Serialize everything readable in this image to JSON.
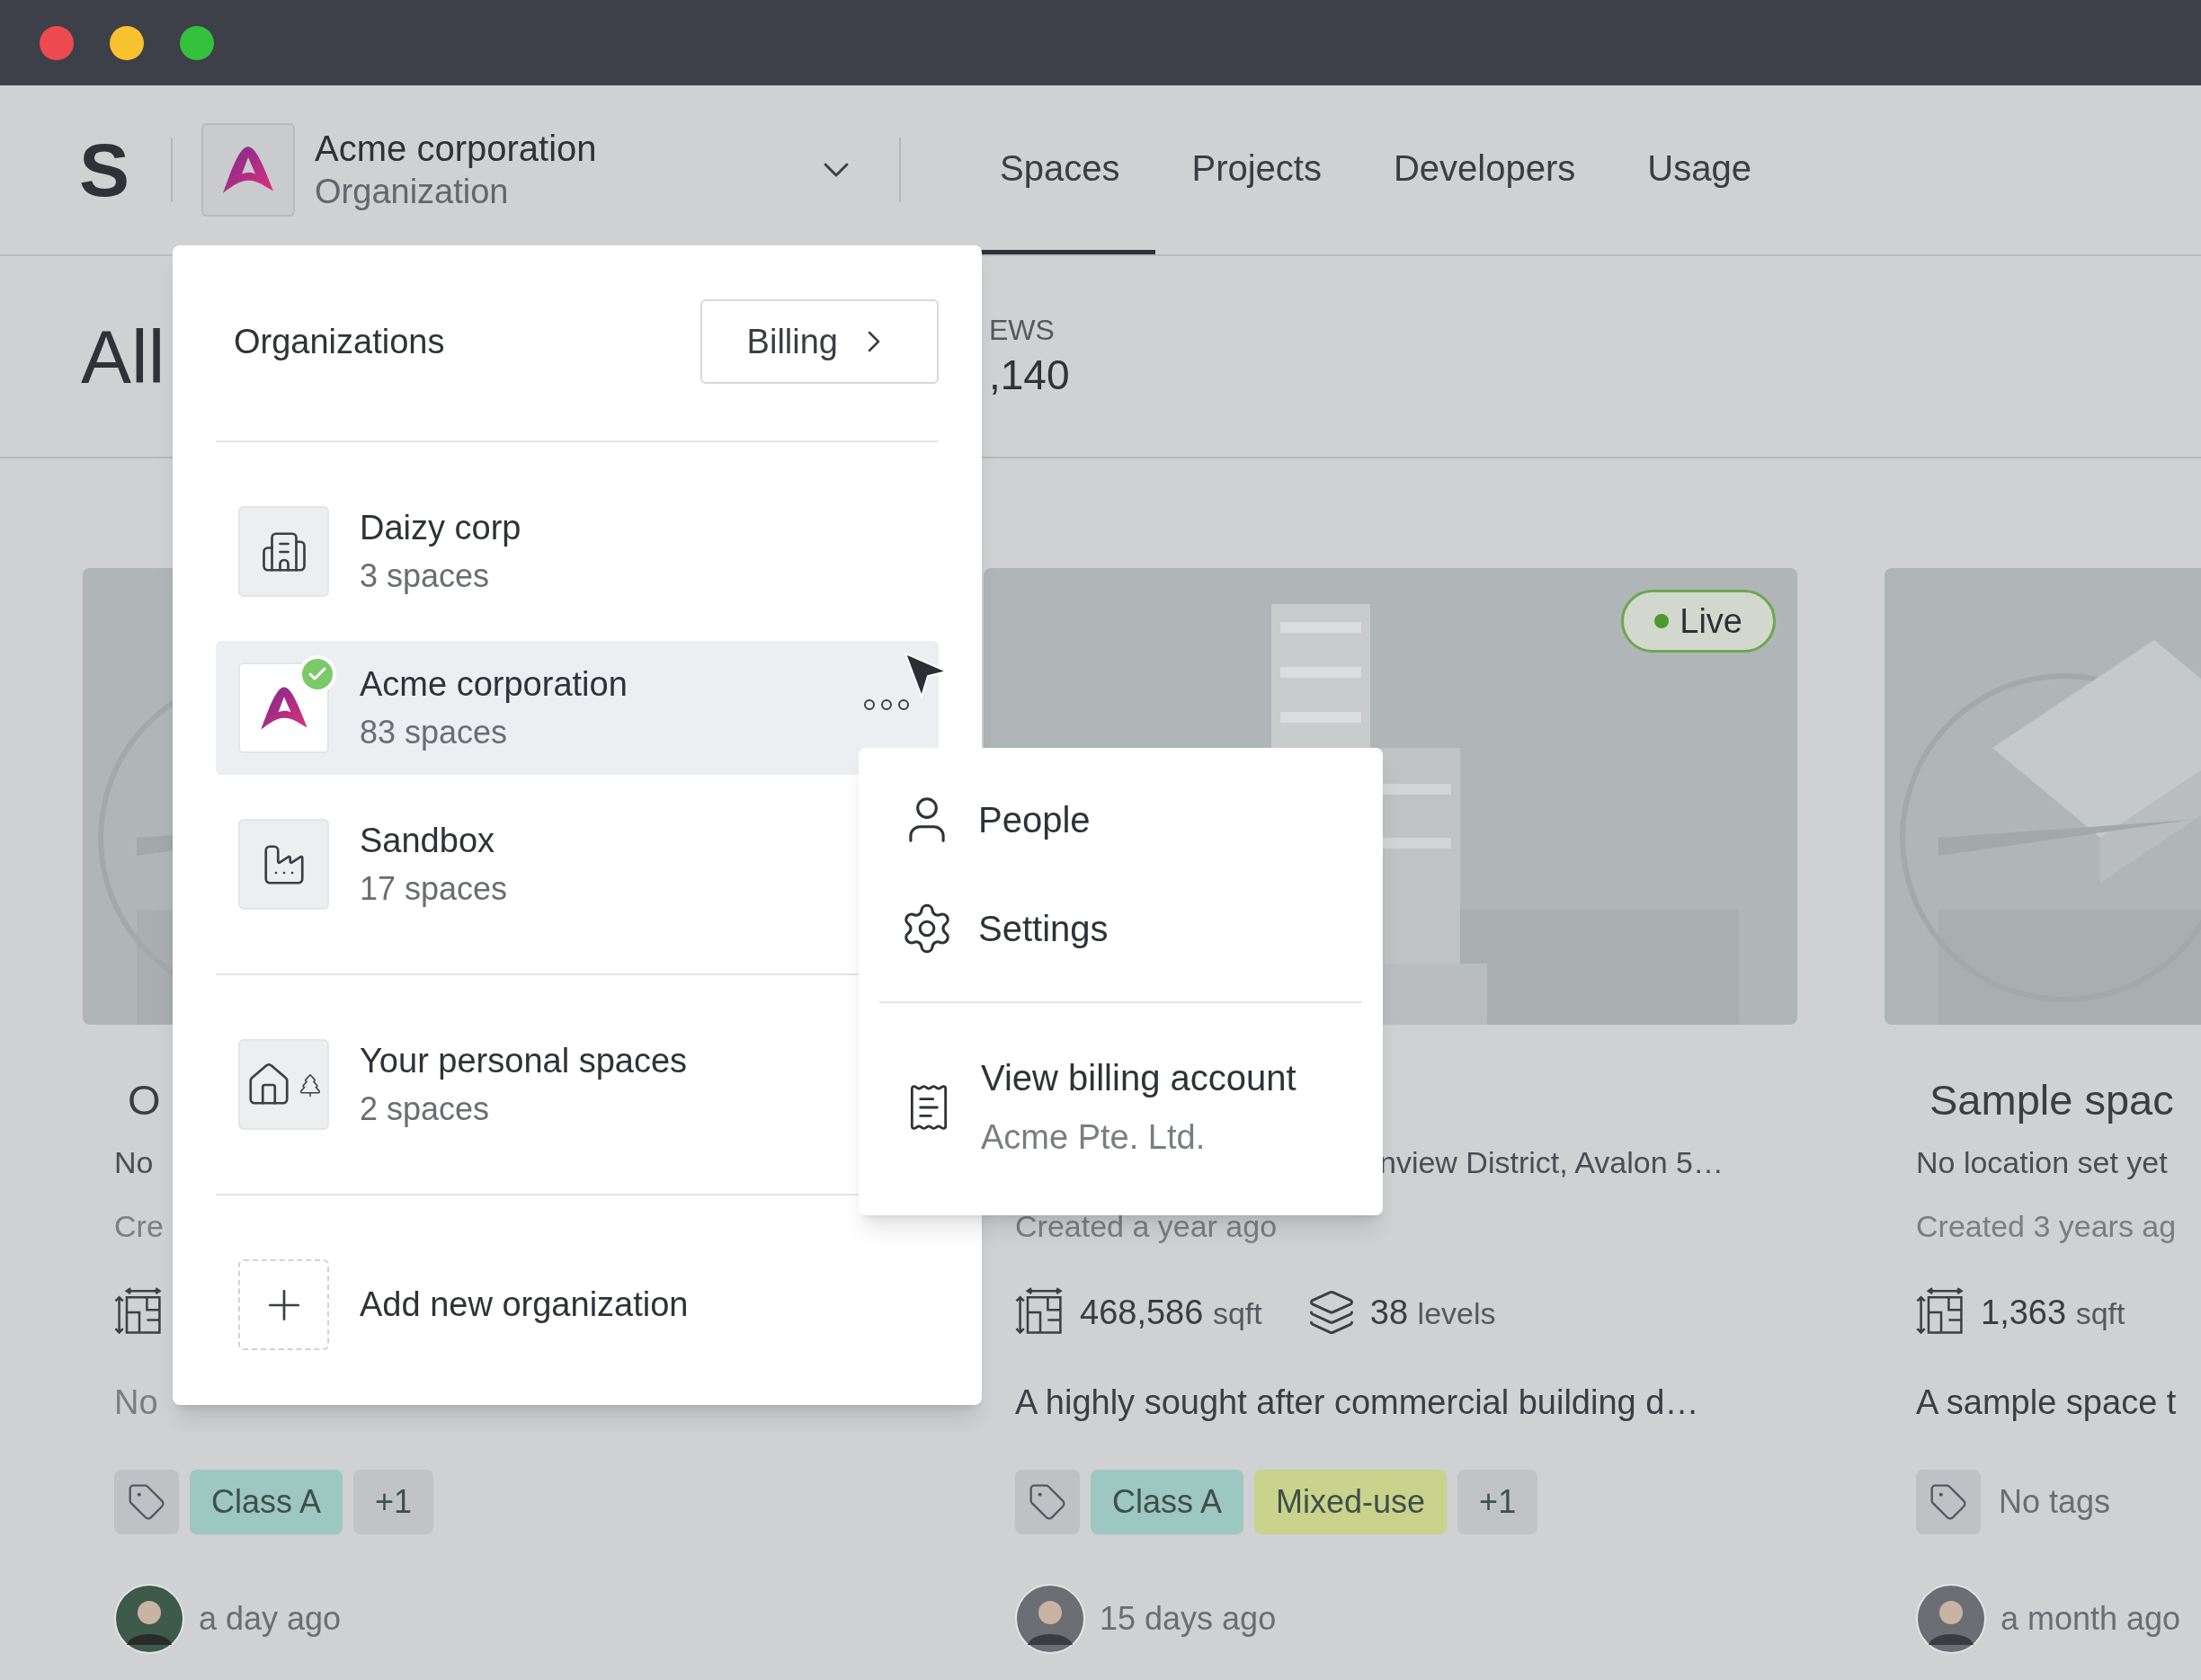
{
  "window": {
    "controls": [
      {
        "color": "#ed4a50"
      },
      {
        "color": "#f8c12e"
      },
      {
        "color": "#34c23e"
      }
    ]
  },
  "header": {
    "logo": "S",
    "org": {
      "name": "Acme corporation",
      "type": "Organization"
    },
    "nav": [
      {
        "label": "Spaces",
        "selected": true
      },
      {
        "label": "Projects",
        "selected": false
      },
      {
        "label": "Developers",
        "selected": false
      },
      {
        "label": "Usage",
        "selected": false
      }
    ]
  },
  "page": {
    "title": "All",
    "stat": {
      "label": "EWS",
      "value": ",140"
    }
  },
  "cards": [
    {
      "title": "O",
      "location": "No",
      "created": "Cre",
      "stats": [
        {
          "kind": "area"
        }
      ],
      "notes": "No",
      "tags": [
        {
          "label": "Class A",
          "color": "#9dc7c1"
        },
        {
          "label": "+1",
          "color": "#c1c4c7"
        }
      ],
      "updated": "a day ago"
    },
    {
      "location": "nview District, Avalon 5…",
      "created": "Created a year ago",
      "stats": [
        {
          "kind": "area",
          "value": "468,586",
          "unit": "sqft"
        },
        {
          "kind": "levels",
          "value": "38",
          "unit": "levels"
        }
      ],
      "notes": "A highly sought after commercial building d…",
      "tags": [
        {
          "label": "Class A",
          "color": "#9dc7c1"
        },
        {
          "label": "Mixed-use",
          "color": "#c9d38c"
        },
        {
          "label": "+1",
          "color": "#c1c4c7"
        }
      ],
      "updated": "15 days ago",
      "live": "Live"
    },
    {
      "title": "Sample spac",
      "location": "No location set yet",
      "created": "Created 3 years ag",
      "stats": [
        {
          "kind": "area",
          "value": "1,363",
          "unit": "sqft"
        }
      ],
      "notes": "A sample space t",
      "tags_note": "No tags",
      "updated": "a month ago"
    }
  ],
  "org_menu": {
    "title": "Organizations",
    "billing_button": "Billing",
    "groups": [
      [
        {
          "name": "Daizy corp",
          "count": "3 spaces",
          "kind": "buildings",
          "selected": false
        },
        {
          "name": "Acme corporation",
          "count": "83 spaces",
          "kind": "logo",
          "selected": true
        },
        {
          "name": "Sandbox",
          "count": "17 spaces",
          "kind": "factory",
          "selected": false
        }
      ],
      [
        {
          "name": "Your personal spaces",
          "count": "2 spaces",
          "kind": "home",
          "selected": false
        }
      ]
    ],
    "add_label": "Add new organization"
  },
  "context_menu": {
    "items": [
      {
        "label": "People",
        "kind": "people"
      },
      {
        "label": "Settings",
        "kind": "settings"
      }
    ],
    "billing": {
      "label": "View billing account",
      "account": "Acme Pte. Ltd."
    }
  }
}
